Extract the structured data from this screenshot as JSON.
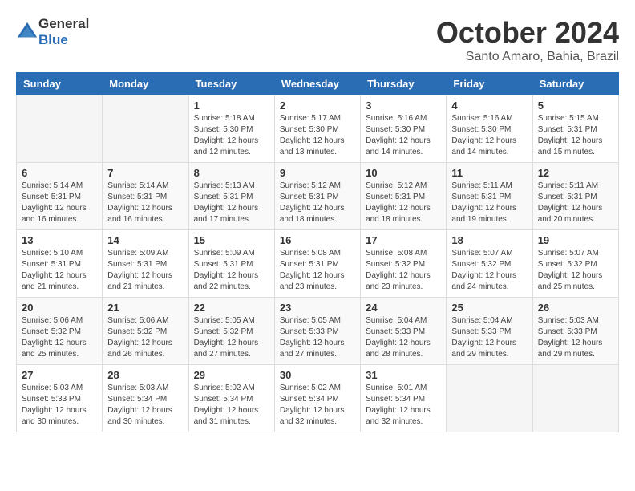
{
  "logo": {
    "text1": "General",
    "text2": "Blue"
  },
  "title": "October 2024",
  "location": "Santo Amaro, Bahia, Brazil",
  "weekdays": [
    "Sunday",
    "Monday",
    "Tuesday",
    "Wednesday",
    "Thursday",
    "Friday",
    "Saturday"
  ],
  "weeks": [
    [
      {
        "day": "",
        "info": ""
      },
      {
        "day": "",
        "info": ""
      },
      {
        "day": "1",
        "info": "Sunrise: 5:18 AM\nSunset: 5:30 PM\nDaylight: 12 hours\nand 12 minutes."
      },
      {
        "day": "2",
        "info": "Sunrise: 5:17 AM\nSunset: 5:30 PM\nDaylight: 12 hours\nand 13 minutes."
      },
      {
        "day": "3",
        "info": "Sunrise: 5:16 AM\nSunset: 5:30 PM\nDaylight: 12 hours\nand 14 minutes."
      },
      {
        "day": "4",
        "info": "Sunrise: 5:16 AM\nSunset: 5:30 PM\nDaylight: 12 hours\nand 14 minutes."
      },
      {
        "day": "5",
        "info": "Sunrise: 5:15 AM\nSunset: 5:31 PM\nDaylight: 12 hours\nand 15 minutes."
      }
    ],
    [
      {
        "day": "6",
        "info": "Sunrise: 5:14 AM\nSunset: 5:31 PM\nDaylight: 12 hours\nand 16 minutes."
      },
      {
        "day": "7",
        "info": "Sunrise: 5:14 AM\nSunset: 5:31 PM\nDaylight: 12 hours\nand 16 minutes."
      },
      {
        "day": "8",
        "info": "Sunrise: 5:13 AM\nSunset: 5:31 PM\nDaylight: 12 hours\nand 17 minutes."
      },
      {
        "day": "9",
        "info": "Sunrise: 5:12 AM\nSunset: 5:31 PM\nDaylight: 12 hours\nand 18 minutes."
      },
      {
        "day": "10",
        "info": "Sunrise: 5:12 AM\nSunset: 5:31 PM\nDaylight: 12 hours\nand 18 minutes."
      },
      {
        "day": "11",
        "info": "Sunrise: 5:11 AM\nSunset: 5:31 PM\nDaylight: 12 hours\nand 19 minutes."
      },
      {
        "day": "12",
        "info": "Sunrise: 5:11 AM\nSunset: 5:31 PM\nDaylight: 12 hours\nand 20 minutes."
      }
    ],
    [
      {
        "day": "13",
        "info": "Sunrise: 5:10 AM\nSunset: 5:31 PM\nDaylight: 12 hours\nand 21 minutes."
      },
      {
        "day": "14",
        "info": "Sunrise: 5:09 AM\nSunset: 5:31 PM\nDaylight: 12 hours\nand 21 minutes."
      },
      {
        "day": "15",
        "info": "Sunrise: 5:09 AM\nSunset: 5:31 PM\nDaylight: 12 hours\nand 22 minutes."
      },
      {
        "day": "16",
        "info": "Sunrise: 5:08 AM\nSunset: 5:31 PM\nDaylight: 12 hours\nand 23 minutes."
      },
      {
        "day": "17",
        "info": "Sunrise: 5:08 AM\nSunset: 5:32 PM\nDaylight: 12 hours\nand 23 minutes."
      },
      {
        "day": "18",
        "info": "Sunrise: 5:07 AM\nSunset: 5:32 PM\nDaylight: 12 hours\nand 24 minutes."
      },
      {
        "day": "19",
        "info": "Sunrise: 5:07 AM\nSunset: 5:32 PM\nDaylight: 12 hours\nand 25 minutes."
      }
    ],
    [
      {
        "day": "20",
        "info": "Sunrise: 5:06 AM\nSunset: 5:32 PM\nDaylight: 12 hours\nand 25 minutes."
      },
      {
        "day": "21",
        "info": "Sunrise: 5:06 AM\nSunset: 5:32 PM\nDaylight: 12 hours\nand 26 minutes."
      },
      {
        "day": "22",
        "info": "Sunrise: 5:05 AM\nSunset: 5:32 PM\nDaylight: 12 hours\nand 27 minutes."
      },
      {
        "day": "23",
        "info": "Sunrise: 5:05 AM\nSunset: 5:33 PM\nDaylight: 12 hours\nand 27 minutes."
      },
      {
        "day": "24",
        "info": "Sunrise: 5:04 AM\nSunset: 5:33 PM\nDaylight: 12 hours\nand 28 minutes."
      },
      {
        "day": "25",
        "info": "Sunrise: 5:04 AM\nSunset: 5:33 PM\nDaylight: 12 hours\nand 29 minutes."
      },
      {
        "day": "26",
        "info": "Sunrise: 5:03 AM\nSunset: 5:33 PM\nDaylight: 12 hours\nand 29 minutes."
      }
    ],
    [
      {
        "day": "27",
        "info": "Sunrise: 5:03 AM\nSunset: 5:33 PM\nDaylight: 12 hours\nand 30 minutes."
      },
      {
        "day": "28",
        "info": "Sunrise: 5:03 AM\nSunset: 5:34 PM\nDaylight: 12 hours\nand 30 minutes."
      },
      {
        "day": "29",
        "info": "Sunrise: 5:02 AM\nSunset: 5:34 PM\nDaylight: 12 hours\nand 31 minutes."
      },
      {
        "day": "30",
        "info": "Sunrise: 5:02 AM\nSunset: 5:34 PM\nDaylight: 12 hours\nand 32 minutes."
      },
      {
        "day": "31",
        "info": "Sunrise: 5:01 AM\nSunset: 5:34 PM\nDaylight: 12 hours\nand 32 minutes."
      },
      {
        "day": "",
        "info": ""
      },
      {
        "day": "",
        "info": ""
      }
    ]
  ]
}
